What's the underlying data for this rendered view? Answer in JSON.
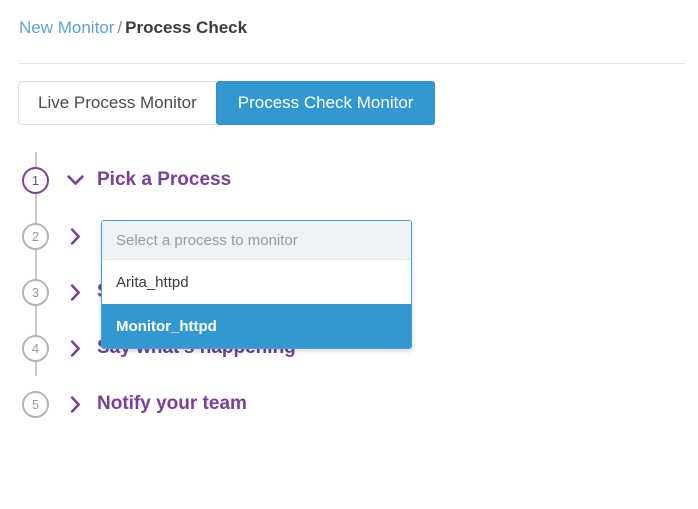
{
  "breadcrumb": {
    "parent_label": "New Monitor",
    "separator": "/",
    "current_label": "Process Check"
  },
  "tabs": [
    {
      "label": "Live Process Monitor",
      "active": false
    },
    {
      "label": "Process Check Monitor",
      "active": true
    }
  ],
  "steps": [
    {
      "number": "1",
      "label": "Pick a Process",
      "expanded": true,
      "chevron": "chevron-down"
    },
    {
      "number": "2",
      "label": "",
      "expanded": false,
      "chevron": "chevron-right"
    },
    {
      "number": "3",
      "label": "Set alert conditions",
      "expanded": false,
      "chevron": "chevron-right"
    },
    {
      "number": "4",
      "label": "Say what's happening",
      "expanded": false,
      "chevron": "chevron-right"
    },
    {
      "number": "5",
      "label": "Notify your team",
      "expanded": false,
      "chevron": "chevron-right"
    }
  ],
  "process_dropdown": {
    "placeholder": "Select a process to monitor",
    "options": [
      {
        "label": "Arita_httpd",
        "selected": false
      },
      {
        "label": "Monitor_httpd",
        "selected": true
      }
    ]
  },
  "colors": {
    "accent_blue": "#3498d0",
    "link_blue": "#5aa3e0",
    "step_purple": "#7a3f9e",
    "step_inactive_gray": "#b4b4b4",
    "rule_gray": "#e6e6e6"
  }
}
